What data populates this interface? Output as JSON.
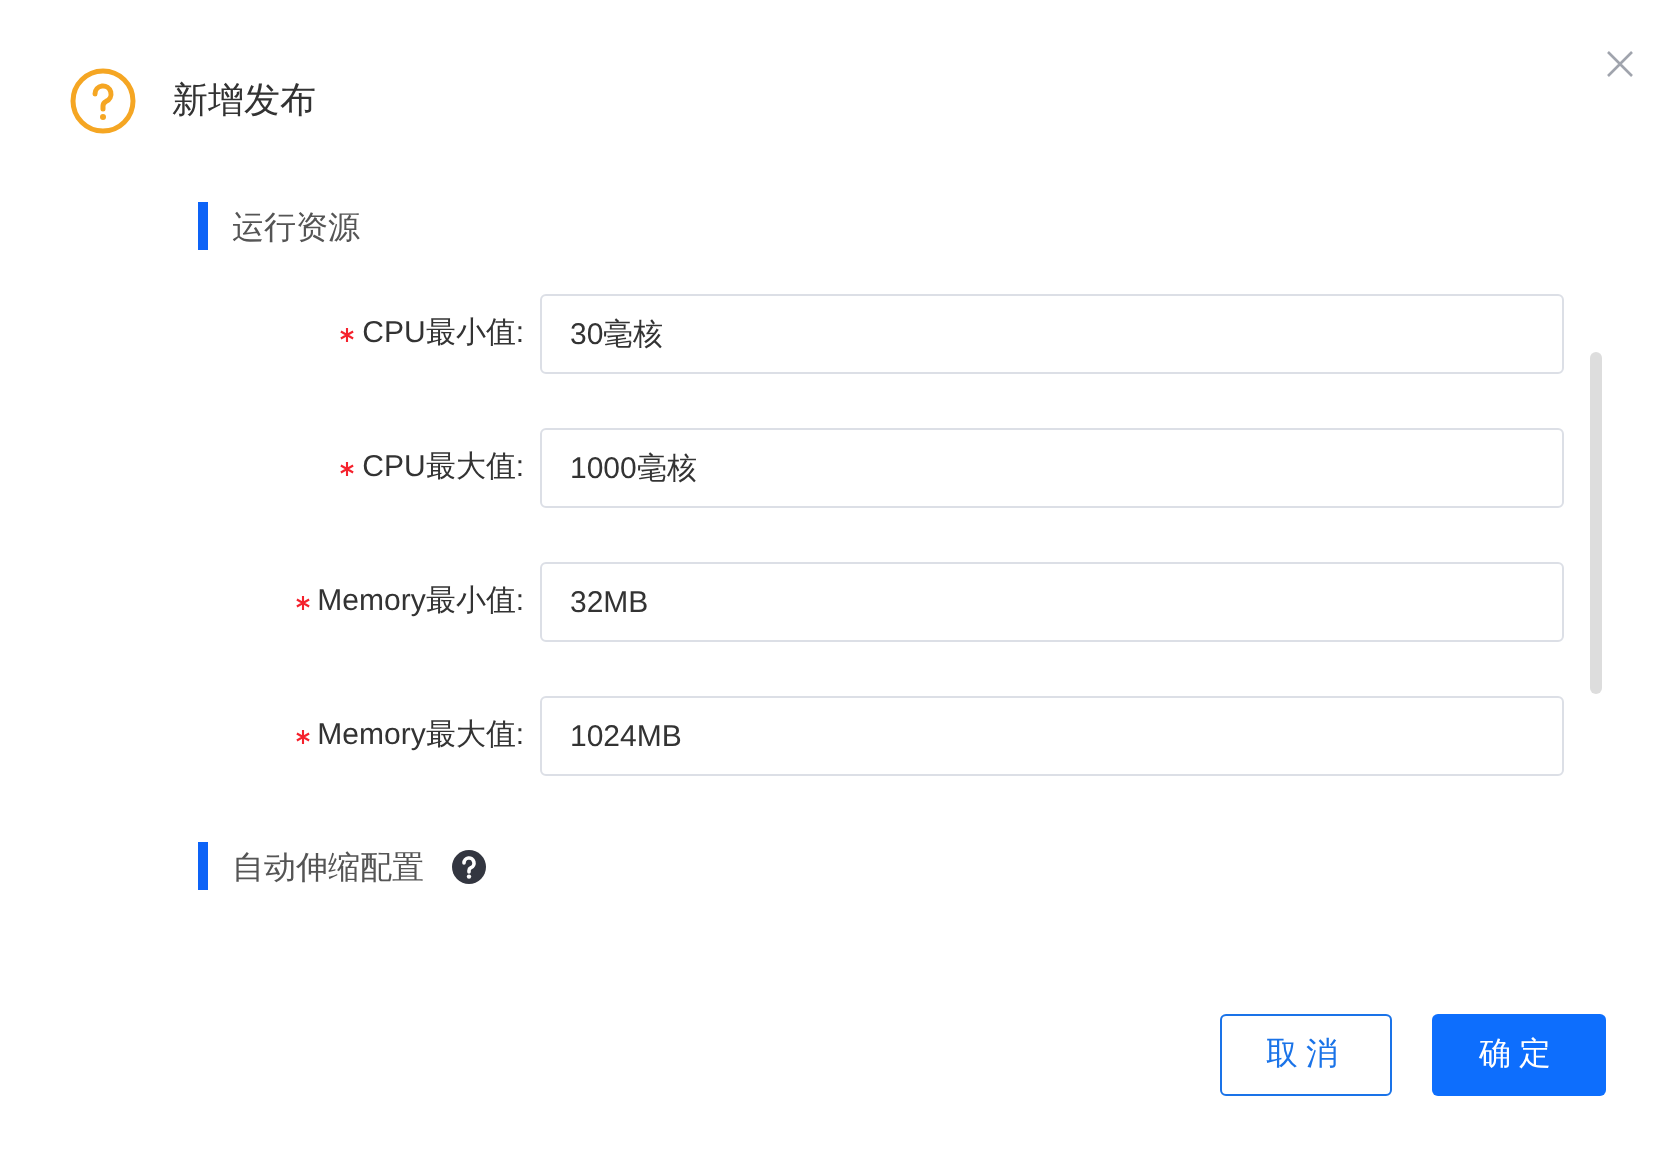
{
  "dialog": {
    "title": "新增发布"
  },
  "sections": [
    {
      "title": "运行资源",
      "help": false,
      "fields": [
        {
          "label": "CPU最小值:",
          "required": true,
          "value": "30毫核"
        },
        {
          "label": "CPU最大值:",
          "required": true,
          "value": "1000毫核"
        },
        {
          "label": "Memory最小值:",
          "required": true,
          "value": "32MB"
        },
        {
          "label": "Memory最大值:",
          "required": true,
          "value": "1024MB"
        }
      ]
    },
    {
      "title": "自动伸缩配置",
      "help": true
    }
  ],
  "buttons": [
    {
      "label": "取消",
      "kind": "secondary"
    },
    {
      "label": "确定",
      "kind": "primary"
    }
  ]
}
